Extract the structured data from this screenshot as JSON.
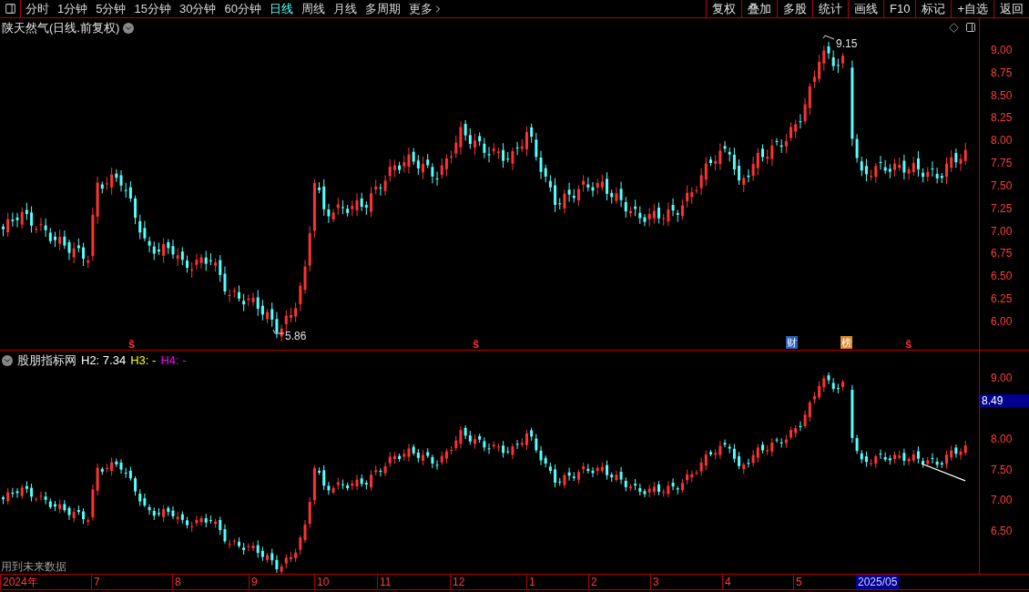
{
  "toolbar": {
    "periods": [
      {
        "label": "分时",
        "selected": false
      },
      {
        "label": "1分钟",
        "selected": false
      },
      {
        "label": "5分钟",
        "selected": false
      },
      {
        "label": "15分钟",
        "selected": false
      },
      {
        "label": "30分钟",
        "selected": false
      },
      {
        "label": "60分钟",
        "selected": false
      },
      {
        "label": "日线",
        "selected": true
      },
      {
        "label": "周线",
        "selected": false
      },
      {
        "label": "月线",
        "selected": false
      },
      {
        "label": "多周期",
        "selected": false
      }
    ],
    "more": "更多",
    "actions": [
      "复权",
      "叠加",
      "多股",
      "统计",
      "画线",
      "F10",
      "标记",
      "+自选",
      "返回"
    ]
  },
  "main_pane": {
    "title": "陕天然气(日线.前复权)",
    "price_axis": [
      "9.00",
      "8.75",
      "8.50",
      "8.25",
      "8.00",
      "7.75",
      "7.50",
      "7.25",
      "7.00",
      "6.75",
      "6.50",
      "6.25",
      "6.00"
    ],
    "high_label": "9.15",
    "low_label": "5.86",
    "event_marks": [
      {
        "kind": "signal",
        "text": "ŝ"
      },
      {
        "kind": "signal",
        "text": "ŝ"
      },
      {
        "kind": "badge",
        "text": "财",
        "color": "#2f5fb8"
      },
      {
        "kind": "badge",
        "text": "榜",
        "color": "#d98a2b"
      },
      {
        "kind": "signal",
        "text": "ŝ"
      }
    ]
  },
  "indicator_pane": {
    "name": "股朋指标网",
    "values": [
      {
        "label": "H2:",
        "value": "7.34",
        "color": "#ffffff"
      },
      {
        "label": "H3:",
        "value": "-",
        "color": "#ffff00"
      },
      {
        "label": "H4:",
        "value": "-",
        "color": "#ff00ff"
      }
    ],
    "price_axis": [
      "9.00",
      "8.00",
      "7.50",
      "7.00",
      "6.50"
    ],
    "current_price": "8.49",
    "footnote": "用到未来数据"
  },
  "time_axis": {
    "labels": [
      "2024年",
      "7",
      "8",
      "9",
      "10",
      "11",
      "12",
      "1",
      "2",
      "3",
      "4",
      "5"
    ],
    "current": "2025/05"
  }
}
